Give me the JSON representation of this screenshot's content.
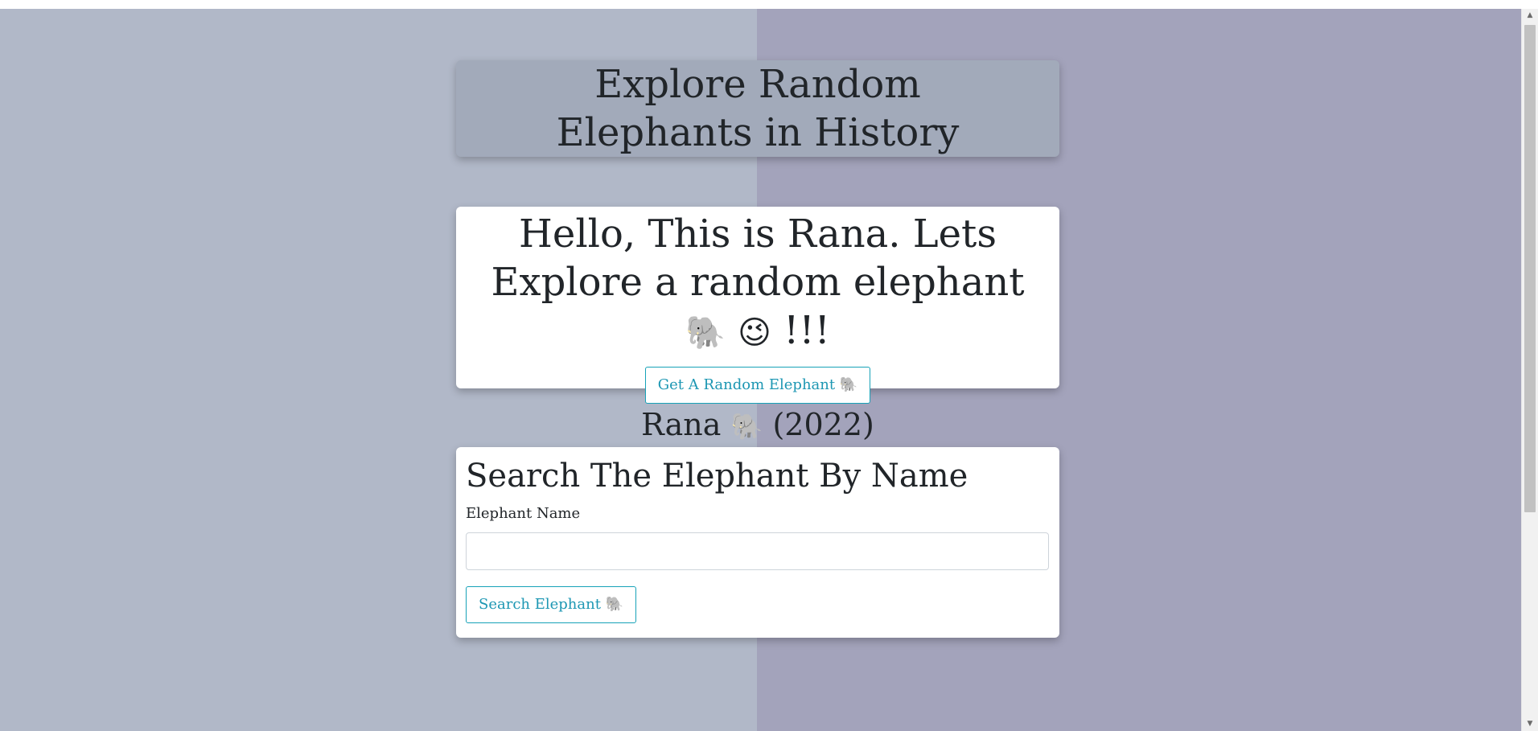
{
  "header": {
    "title": "Explore Random Elephants in History"
  },
  "intro": {
    "greeting": "Hello, This is Rana. Lets Explore a random elephant",
    "elephant_emoji": "🐘",
    "wink_emoji": "😉",
    "exclaim": "!!!",
    "random_button_label": "Get A Random Elephant",
    "random_button_emoji": "🐘",
    "result_name": "Rana",
    "result_emoji": "🐘",
    "result_year": "(2022)"
  },
  "search": {
    "heading": "Search The Elephant By Name",
    "field_label": "Elephant Name",
    "input_value": "",
    "button_label": "Search Elephant",
    "button_emoji": "🐘"
  },
  "colors": {
    "left_background": "#b1b8c8",
    "right_background": "#a3a3bb",
    "title_card": "#a2aaba",
    "accent": "#17a2b8"
  }
}
